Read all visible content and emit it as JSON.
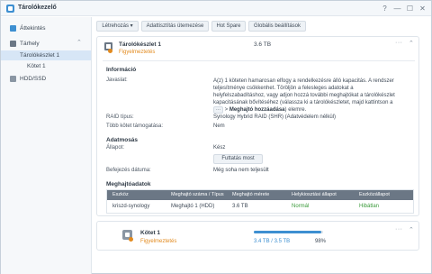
{
  "window": {
    "title": "Tárolókezelő",
    "icon": "storage-manager-icon"
  },
  "window_controls": {
    "help": "?",
    "minimize": "—",
    "maximize": "☐",
    "close": "✕"
  },
  "sidebar": {
    "overview": {
      "label": "Áttekintés",
      "icon": "overview-icon"
    },
    "storage": {
      "label": "Tárhely",
      "icon": "storage-icon",
      "chevron": "⌃"
    },
    "pool": {
      "label": "Tárolókészlet 1"
    },
    "volume": {
      "label": "Kötet 1"
    },
    "hdd": {
      "label": "HDD/SSD",
      "icon": "hdd-icon"
    }
  },
  "toolbar": {
    "create": "Létrehozás ▾",
    "scrub_schedule": "Adattisztítás ütemezése",
    "hot_spare": "Hot Spare",
    "global_settings": "Globális beállítások"
  },
  "pool": {
    "name": "Tárolókészlet 1",
    "status": "Figyelmeztetés",
    "size": "3.6 TB",
    "more": "···",
    "collapse": "⌃",
    "info_title": "Információ",
    "suggestion_label": "Javaslat:",
    "suggestion_1": "A(z) 1 köteten hamarosan elfogy a rendelkezésre álló kapacitás. A rendszer teljesítménye csökkenhet. Töröljön a felesleges adatokat a helyfelszabadításhoz, vagy adjon hozzá további meghajtókat a tárolókészlet kapacitásának bővítéséhez (válassza ki a tárolókészletet, majd kattintson a",
    "suggestion_key": "···",
    "suggestion_2": "> ",
    "suggestion_bold": "Meghajtó hozzáadása",
    "suggestion_3": ") elemre.",
    "raid_label": "RAID típus:",
    "raid_value": "Synology Hybrid RAID (SHR) (Adatvédelem nélkül)",
    "multi_volume_label": "Több kötet támogatása:",
    "multi_volume_value": "Nem",
    "scrub_title": "Adatmosás",
    "state_label": "Állapot:",
    "state_value": "Kész",
    "run_now": "Futtatás most",
    "finished_label": "Befejezés dátuma:",
    "finished_value": "Még soha nem teljesült",
    "drive_info_title": "Meghajtóadatok"
  },
  "drive_table": {
    "headers": [
      "Eszköz",
      "Meghajtó száma / Típus",
      "Meghajtó mérete",
      "Helykiosztási állapot",
      "Eszközállapot"
    ],
    "rows": [
      [
        "kriszd-synology",
        "Meghajtó 1 (HDD)",
        "3.6 TB",
        "Normál",
        "Hibátlan"
      ]
    ]
  },
  "volume": {
    "name": "Kötet 1",
    "status": "Figyelmeztetés",
    "usage_text": "3.4 TB / 3.5 TB",
    "usage_percent": "98%",
    "usage_fraction": 0.98,
    "more": "···",
    "collapse": "⌃"
  },
  "colors": {
    "accent": "#3d8fd1",
    "warning": "#e28a1e",
    "ok": "#3a9a3a",
    "table_header": "#6b7785"
  }
}
